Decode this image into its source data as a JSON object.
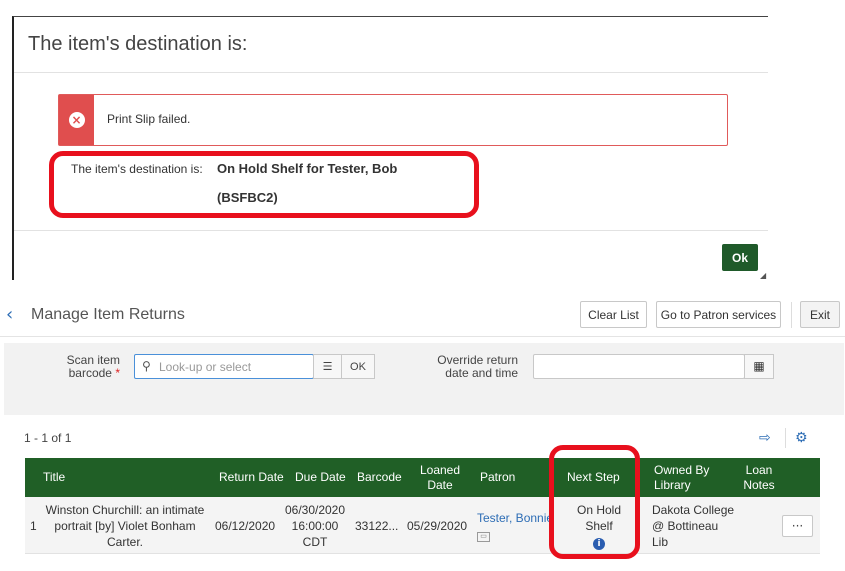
{
  "modal": {
    "title": "The item's destination is:",
    "alert_icon": "x-circle-icon",
    "alert_text": "Print Slip failed.",
    "dest_label": "The item's destination is:",
    "dest_value": "On Hold Shelf for Tester, Bob",
    "dest_code": "(BSFBC2)",
    "ok_label": "Ok",
    "highlight_color": "#e8101d",
    "alert_color": "#e04e4e",
    "ok_color": "#1f5a2a"
  },
  "header": {
    "back_icon": "chevron-left-icon",
    "title": "Manage Item Returns",
    "clear_label": "Clear List",
    "patron_label": "Go to Patron services",
    "exit_label": "Exit"
  },
  "form": {
    "scan_label_1": "Scan item",
    "scan_label_2": "barcode",
    "required_mark": "*",
    "scan_placeholder": "Look-up or select",
    "scan_value": "",
    "ok_label": "OK",
    "override_label_1": "Override return",
    "override_label_2": "date and time",
    "override_value": ""
  },
  "results": {
    "count": "1 - 1 of 1"
  },
  "table": {
    "header_color": "#205f26",
    "columns": {
      "title": "Title",
      "return_date": "Return Date",
      "due_date": "Due Date",
      "barcode": "Barcode",
      "loaned_1": "Loaned",
      "loaned_2": "Date",
      "patron": "Patron",
      "next_step": "Next Step",
      "owned_1": "Owned By",
      "owned_2": "Library",
      "loan_notes_1": "Loan",
      "loan_notes_2": "Notes"
    },
    "rows": [
      {
        "num": "1",
        "title_1": "Winston Churchill: an intimate",
        "title_2": "portrait [by] Violet Bonham",
        "title_3": "Carter.",
        "return_date": "06/12/2020",
        "due_1": "06/30/2020",
        "due_2": "16:00:00",
        "due_3": "CDT",
        "barcode": "33122...",
        "loaned": "05/29/2020",
        "patron": "Tester, Bonnie",
        "next_step": "On Hold Shelf",
        "owned_1": "Dakota College",
        "owned_2": "@ Bottineau",
        "owned_3": "Lib",
        "more_label": "···"
      }
    ]
  }
}
